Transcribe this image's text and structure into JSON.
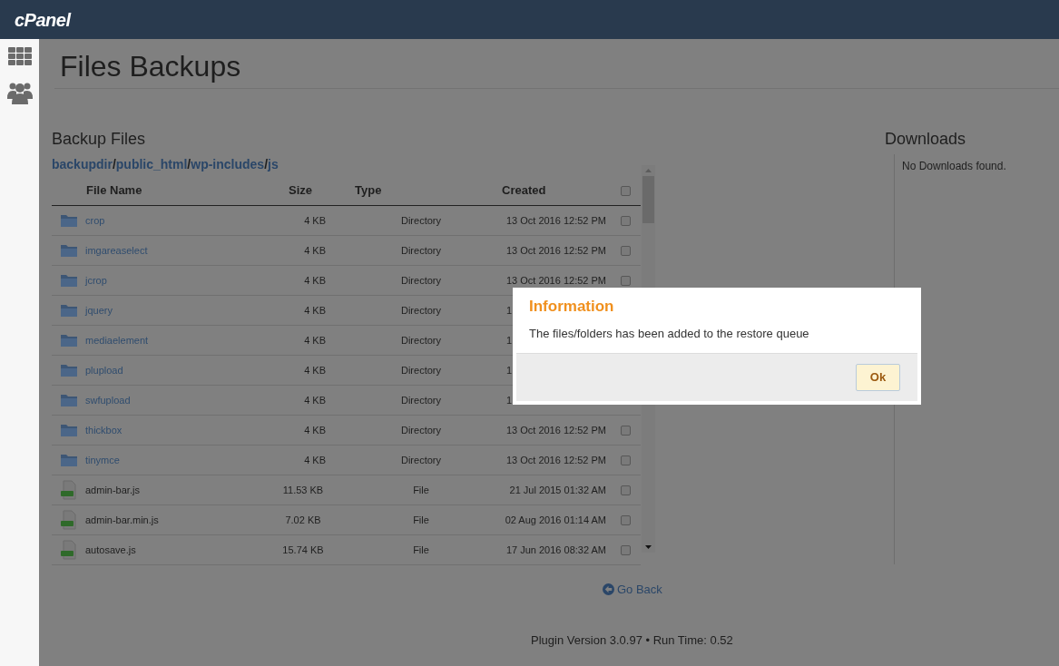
{
  "header": {
    "logo": "cPanel"
  },
  "page": {
    "title": "Files Backups"
  },
  "backup_files": {
    "title": "Backup Files",
    "breadcrumb": {
      "separator": "/",
      "segments": [
        "backupdir",
        "public_html",
        "wp-includes",
        "js"
      ]
    },
    "table": {
      "columns": [
        "File Name",
        "Size",
        "Type",
        "Created"
      ],
      "all_checked": false,
      "rows": [
        {
          "kind": "directory",
          "name": "crop",
          "size": "4 KB",
          "type": "Directory",
          "created": "13 Oct 2016 12:52 PM",
          "checked": false
        },
        {
          "kind": "directory",
          "name": "imgareaselect",
          "size": "4 KB",
          "type": "Directory",
          "created": "13 Oct 2016 12:52 PM",
          "checked": false
        },
        {
          "kind": "directory",
          "name": "jcrop",
          "size": "4 KB",
          "type": "Directory",
          "created": "13 Oct 2016 12:52 PM",
          "checked": false
        },
        {
          "kind": "directory",
          "name": "jquery",
          "size": "4 KB",
          "type": "Directory",
          "created": "1"
        },
        {
          "kind": "directory",
          "name": "mediaelement",
          "size": "4 KB",
          "type": "Directory",
          "created": "1"
        },
        {
          "kind": "directory",
          "name": "plupload",
          "size": "4 KB",
          "type": "Directory",
          "created": "1"
        },
        {
          "kind": "directory",
          "name": "swfupload",
          "size": "4 KB",
          "type": "Directory",
          "created": "1"
        },
        {
          "kind": "directory",
          "name": "thickbox",
          "size": "4 KB",
          "type": "Directory",
          "created": "13 Oct 2016 12:52 PM",
          "checked": false
        },
        {
          "kind": "directory",
          "name": "tinymce",
          "size": "4 KB",
          "type": "Directory",
          "created": "13 Oct 2016 12:52 PM",
          "checked": false
        },
        {
          "kind": "file",
          "name": "admin-bar.js",
          "size": "11.53 KB",
          "type": "File",
          "created": "21 Jul 2015 01:32 AM",
          "checked": false
        },
        {
          "kind": "file",
          "name": "admin-bar.min.js",
          "size": "7.02 KB",
          "type": "File",
          "created": "02 Aug 2016 01:14 AM",
          "checked": false
        },
        {
          "kind": "file",
          "name": "autosave.js",
          "size": "15.74 KB",
          "type": "File",
          "created": "17 Jun 2016 08:32 AM",
          "checked": false
        }
      ]
    }
  },
  "downloads": {
    "title": "Downloads",
    "empty_text": "No Downloads found."
  },
  "go_back": "Go Back",
  "footer": "Plugin Version 3.0.97 • Run Time: 0.52",
  "dialog": {
    "title": "Information",
    "message": "The files/folders has been added to the restore queue",
    "button": "Ok"
  }
}
